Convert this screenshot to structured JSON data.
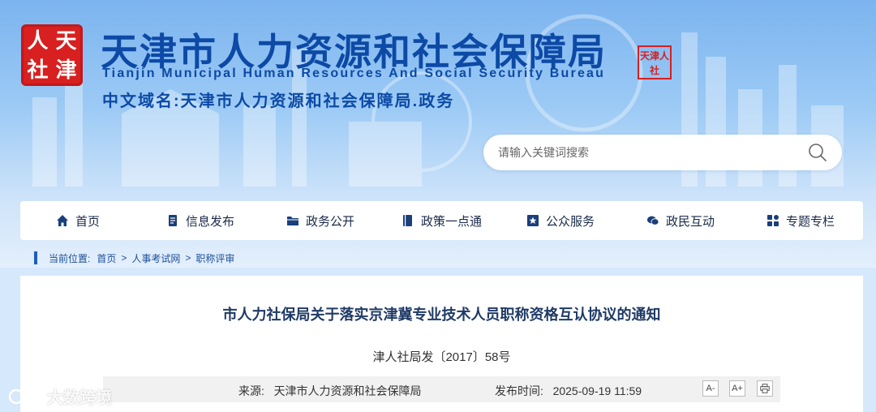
{
  "header": {
    "seal_chars": [
      "人",
      "天",
      "社",
      "津"
    ],
    "title_cn": "天津市人力资源和社会保障局",
    "title_en": "Tianjin Municipal Human Resources And Social Security Bureau",
    "domain_label": "中文域名:天津市人力资源和社会保障局.政务",
    "small_seal": "天津人社"
  },
  "search": {
    "placeholder": "请输入关键词搜索",
    "icon": "search-icon"
  },
  "nav": {
    "items": [
      {
        "label": "首页",
        "icon": "home-icon"
      },
      {
        "label": "信息发布",
        "icon": "document-icon"
      },
      {
        "label": "政务公开",
        "icon": "folder-icon"
      },
      {
        "label": "政策一点通",
        "icon": "book-icon"
      },
      {
        "label": "公众服务",
        "icon": "star-icon"
      },
      {
        "label": "政民互动",
        "icon": "chat-icon"
      },
      {
        "label": "专题专栏",
        "icon": "grid-icon"
      }
    ]
  },
  "breadcrumb": {
    "prefix": "当前位置:",
    "items": [
      "首页",
      "人事考试网",
      "职称评审"
    ],
    "separator": ">"
  },
  "article": {
    "title": "市人力社保局关于落实京津冀专业技术人员职称资格互认协议的通知",
    "doc_number": "津人社局发〔2017〕58号",
    "source_label": "来源:",
    "source": "天津市人力资源和社会保障局",
    "date_label": "发布时间:",
    "date": "2025-09-19 11:59",
    "font_decrease": "A-",
    "font_increase": "A+",
    "print_icon": "print-icon"
  },
  "watermark": {
    "text": "大数跨境"
  },
  "colors": {
    "brand_blue": "#0d4aa6",
    "seal_red": "#d7201f",
    "nav_text": "#1a2a4a",
    "breadcrumb": "#1d4f99"
  }
}
